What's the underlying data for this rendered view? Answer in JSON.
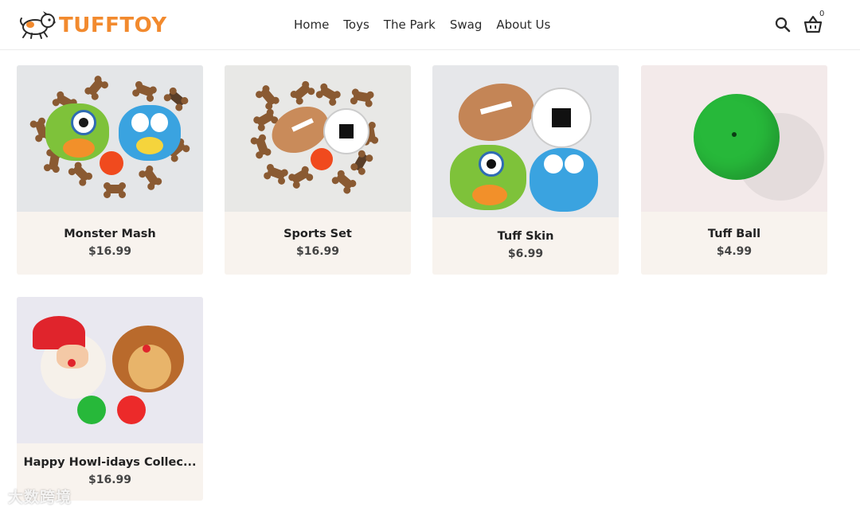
{
  "brand": {
    "name": "TUFFTOY",
    "accent": "#f28a2e"
  },
  "nav": {
    "items": [
      {
        "label": "Home"
      },
      {
        "label": "Toys"
      },
      {
        "label": "The Park"
      },
      {
        "label": "Swag"
      },
      {
        "label": "About Us"
      }
    ]
  },
  "header": {
    "search_icon": "search-icon",
    "cart_icon": "basket-icon",
    "cart_count": "0"
  },
  "products": [
    {
      "name": "Monster Mash",
      "price": "$16.99"
    },
    {
      "name": "Sports Set",
      "price": "$16.99"
    },
    {
      "name": "Tuff Skin",
      "price": "$6.99"
    },
    {
      "name": "Tuff Ball",
      "price": "$4.99"
    },
    {
      "name": "Happy Howl-idays Collec...",
      "price": "$16.99"
    }
  ],
  "colors": {
    "card_bg": "#f8f3ee",
    "text": "#2b2b2b"
  },
  "watermark": "大数跨境"
}
